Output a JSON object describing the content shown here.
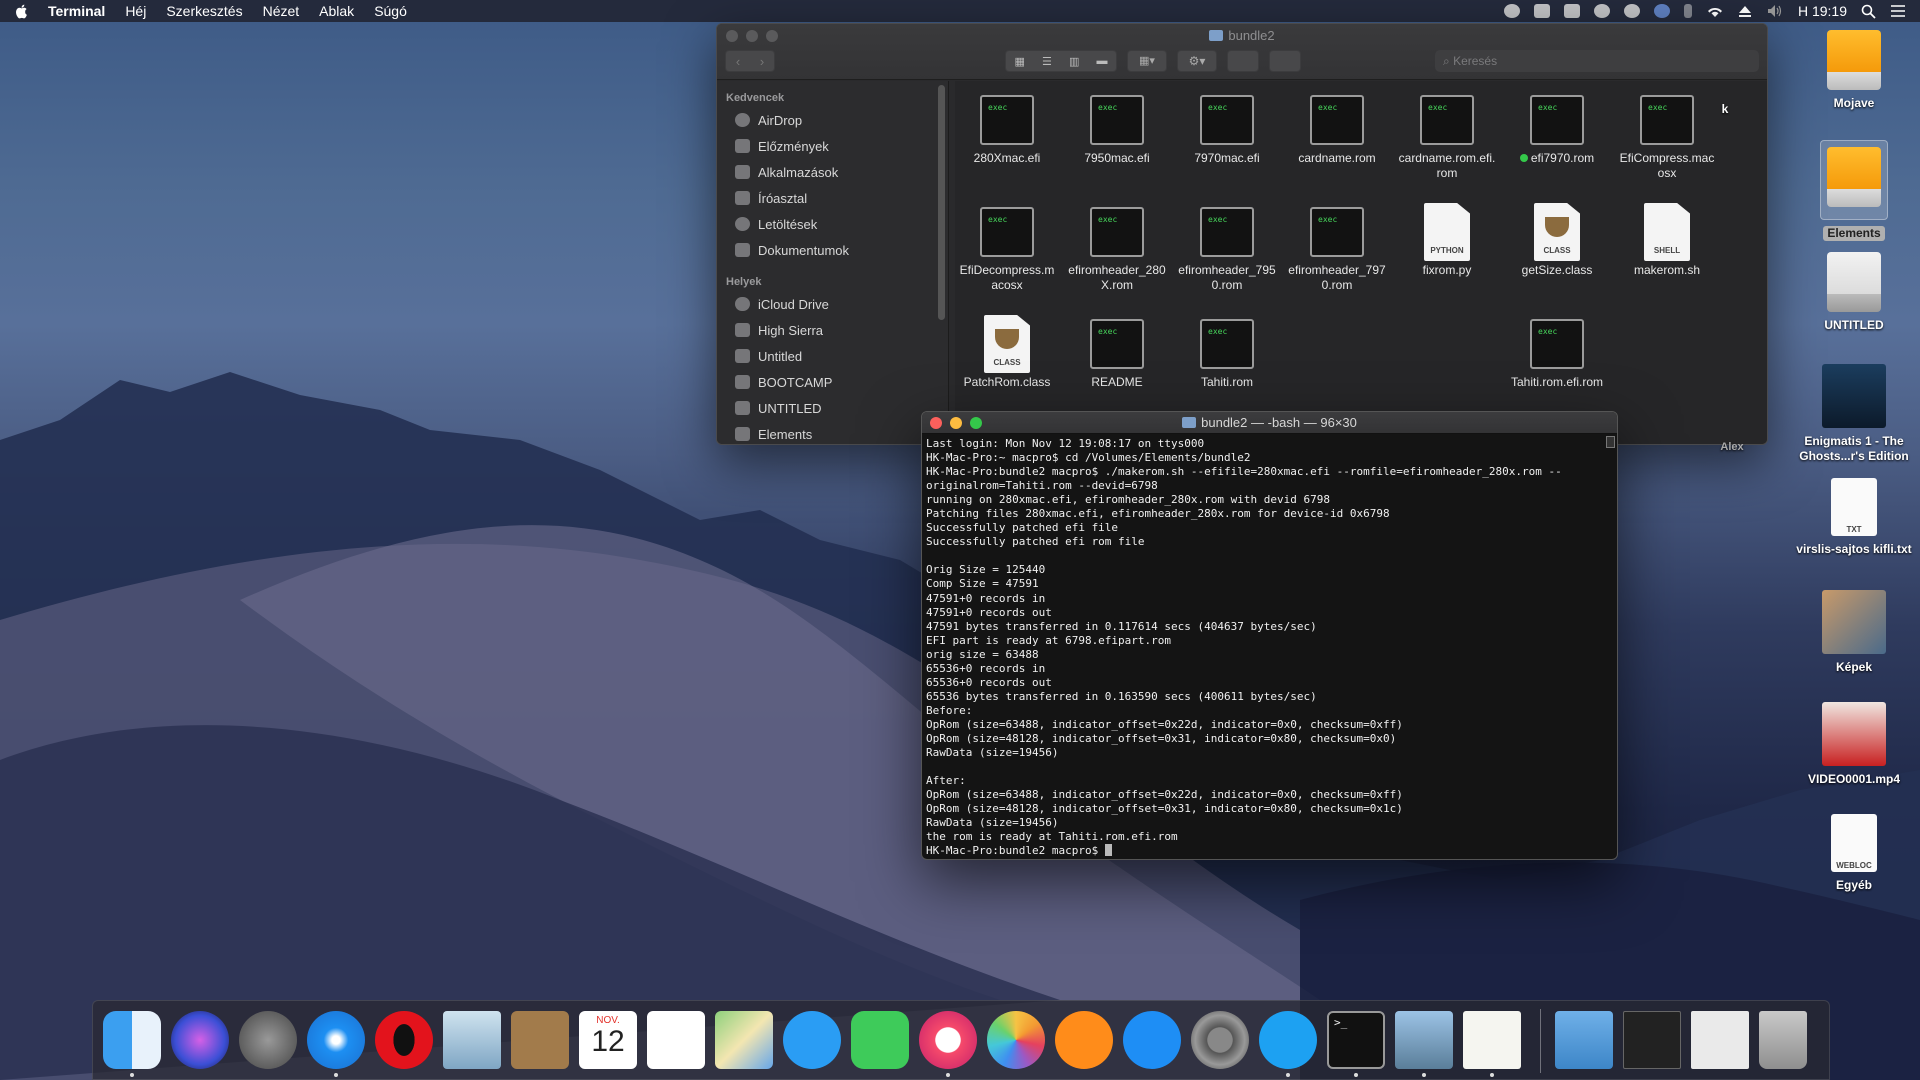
{
  "menubar": {
    "app_name": "Terminal",
    "items": [
      "Héj",
      "Szerkesztés",
      "Nézet",
      "Ablak",
      "Súgó"
    ],
    "clock": "H 19:19"
  },
  "finder": {
    "title": "bundle2",
    "search_placeholder": "Keresés",
    "sidebar": {
      "favorites_header": "Kedvencek",
      "favorites": [
        "AirDrop",
        "Előzmények",
        "Alkalmazások",
        "Íróasztal",
        "Letöltések",
        "Dokumentumok"
      ],
      "places_header": "Helyek",
      "places": [
        "iCloud Drive",
        "High Sierra",
        "Untitled",
        "BOOTCAMP",
        "UNTITLED",
        "Elements"
      ]
    },
    "files": [
      {
        "name": "280Xmac.efi",
        "kind": "exec"
      },
      {
        "name": "7950mac.efi",
        "kind": "exec"
      },
      {
        "name": "7970mac.efi",
        "kind": "exec"
      },
      {
        "name": "cardname.rom",
        "kind": "exec"
      },
      {
        "name": "cardname.rom.efi.\nrom",
        "kind": "exec"
      },
      {
        "name": "efi7970.rom",
        "kind": "exec",
        "tag": "green"
      },
      {
        "name": "EfiCompress.mac\nosx",
        "kind": "exec"
      },
      {
        "name": "EfiDecompress.m\nacosx",
        "kind": "exec"
      },
      {
        "name": "efiromheader_280\nX.rom",
        "kind": "exec"
      },
      {
        "name": "efiromheader_795\n0.rom",
        "kind": "exec"
      },
      {
        "name": "efiromheader_797\n0.rom",
        "kind": "exec"
      },
      {
        "name": "fixrom.py",
        "kind": "doc",
        "label": "PYTHON"
      },
      {
        "name": "getSize.class",
        "kind": "class",
        "label": "CLASS"
      },
      {
        "name": "makerom.sh",
        "kind": "doc",
        "label": "SHELL"
      },
      {
        "name": "PatchRom.class",
        "kind": "class",
        "label": "CLASS"
      },
      {
        "name": "README",
        "kind": "exec"
      },
      {
        "name": "Tahiti.rom",
        "kind": "exec"
      },
      {
        "name": "Tahiti.rom.efi.rom",
        "kind": "exec"
      }
    ],
    "exec_label": "exec"
  },
  "terminal": {
    "title": "bundle2 — -bash — 96×30",
    "lines": [
      "Last login: Mon Nov 12 19:08:17 on ttys000",
      "HK-Mac-Pro:~ macpro$ cd /Volumes/Elements/bundle2",
      "HK-Mac-Pro:bundle2 macpro$ ./makerom.sh --efifile=280xmac.efi --romfile=efiromheader_280x.rom --",
      "originalrom=Tahiti.rom --devid=6798",
      "running on 280xmac.efi, efiromheader_280x.rom with devid 6798",
      "Patching files 280xmac.efi, efiromheader_280x.rom for device-id 0x6798",
      "Successfully patched efi file",
      "Successfully patched efi rom file",
      "",
      "Orig Size = 125440",
      "Comp Size = 47591",
      "47591+0 records in",
      "47591+0 records out",
      "47591 bytes transferred in 0.117614 secs (404637 bytes/sec)",
      "EFI part is ready at 6798.efipart.rom",
      "orig size = 63488",
      "65536+0 records in",
      "65536+0 records out",
      "65536 bytes transferred in 0.163590 secs (400611 bytes/sec)",
      "Before:",
      "OpRom (size=63488, indicator_offset=0x22d, indicator=0x0, checksum=0xff)",
      "OpRom (size=48128, indicator_offset=0x31, indicator=0x80, checksum=0x0)",
      "RawData (size=19456)",
      "",
      "After:",
      "OpRom (size=63488, indicator_offset=0x22d, indicator=0x0, checksum=0xff)",
      "OpRom (size=48128, indicator_offset=0x31, indicator=0x80, checksum=0x1c)",
      "RawData (size=19456)",
      "the rom is ready at Tahiti.rom.efi.rom",
      "HK-Mac-Pro:bundle2 macpro$ "
    ]
  },
  "desktop": {
    "icons": [
      {
        "label": "Mojave",
        "kind": "drive-orange"
      },
      {
        "label": "Elements",
        "kind": "drive-orange",
        "selected": true
      },
      {
        "label": "UNTITLED",
        "kind": "drive-white"
      },
      {
        "label": "Enigmatis 1 - The Ghosts...r's Edition",
        "kind": "game"
      },
      {
        "label": "virslis-sajtos kifli.txt",
        "kind": "txt",
        "badge": "TXT"
      },
      {
        "label": "Képek",
        "kind": "photos"
      },
      {
        "label": "VIDEO0001.mp4",
        "kind": "video"
      },
      {
        "label": "Egyéb",
        "kind": "webloc",
        "badge": "WEBLOC"
      }
    ],
    "partial_labels": [
      "k",
      "Alex"
    ]
  },
  "dock": {
    "calendar_month": "NOV.",
    "calendar_day": "12",
    "apps": [
      "finder",
      "siri",
      "launchpad",
      "safari",
      "opera",
      "mail",
      "contacts",
      "calendar",
      "reminders",
      "maps",
      "messages",
      "facetime",
      "itunes",
      "photos",
      "ibooks",
      "app-store",
      "system-preferences",
      "skype",
      "terminal",
      "preview",
      "textedit"
    ],
    "terminal_prompt": ">_"
  },
  "colors": {
    "finder_bg": "#2a2a2c",
    "terminal_bg": "#141414",
    "tag_green": "#34c84a"
  }
}
